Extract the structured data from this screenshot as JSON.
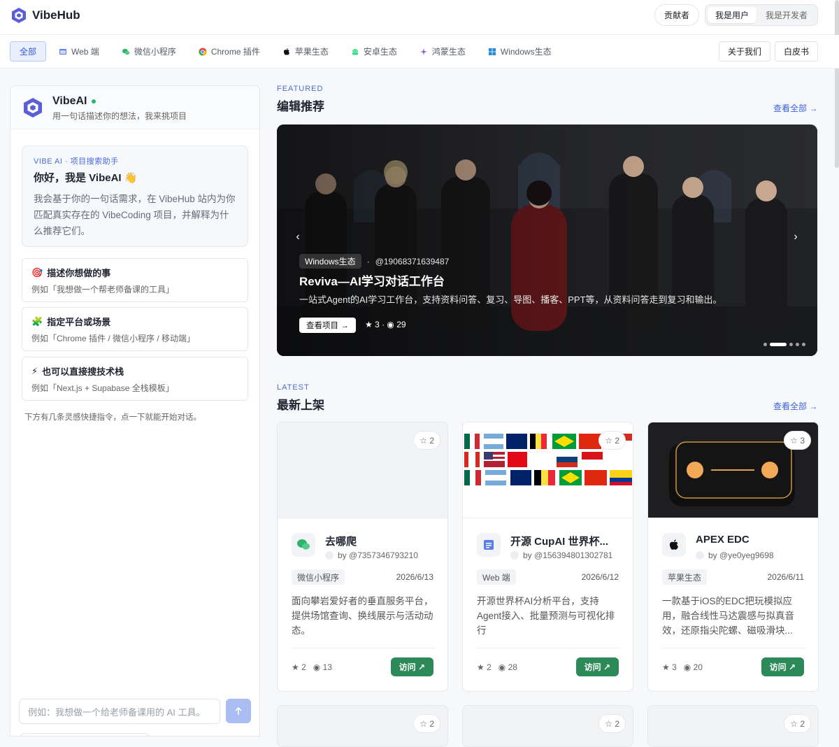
{
  "header": {
    "brand": "VibeHub",
    "contributors": "贡献者",
    "roles": [
      "我是用户",
      "我是开发者"
    ]
  },
  "nav": {
    "items": [
      {
        "label": "全部",
        "icon": "none"
      },
      {
        "label": "Web 端",
        "icon": "web-icon"
      },
      {
        "label": "微信小程序",
        "icon": "wechat-icon"
      },
      {
        "label": "Chrome 插件",
        "icon": "chrome-icon"
      },
      {
        "label": "苹果生态",
        "icon": "apple-icon"
      },
      {
        "label": "安卓生态",
        "icon": "android-icon"
      },
      {
        "label": "鸿蒙生态",
        "icon": "harmony-icon"
      },
      {
        "label": "Windows生态",
        "icon": "windows-icon"
      }
    ],
    "about": "关于我们",
    "whitepaper": "白皮书"
  },
  "chat": {
    "title": "VibeAI",
    "subtitle": "用一句话描述你的想法，我来挑项目",
    "intro_tag": "VIBE AI · 项目搜索助手",
    "intro_title": "你好，我是 VibeAI 👋",
    "intro_body": "我会基于你的一句话需求，在 VibeHub 站内为你匹配真实存在的 VibeCoding 项目，并解释为什么推荐它们。",
    "tips": [
      {
        "icon": "target-icon",
        "emoji": "🎯",
        "title": "描述你想做的事",
        "desc": "例如「我想做一个帮老师备课的工具」"
      },
      {
        "icon": "puzzle-icon",
        "emoji": "🧩",
        "title": "指定平台或场景",
        "desc": "例如「Chrome 插件 / 微信小程序 / 移动端」"
      },
      {
        "icon": "bolt-icon",
        "emoji": "⚡",
        "title": "也可以直接搜技术栈",
        "desc": "例如「Next.js + Supabase 全栈模板」"
      }
    ],
    "note": "下方有几条灵感快捷指令，点一下就能开始对话。",
    "placeholder": "例如：我想做一个给老师备课用的 AI 工具。"
  },
  "featured": {
    "kicker": "FEATURED",
    "title": "编辑推荐",
    "see_all": "查看全部 →",
    "platform": "Windows生态",
    "author": "@19068371639487",
    "project_title": "Reviva—AI学习对话工作台",
    "desc": "一站式Agent的AI学习工作台，支持资料问答、复习、导图、播客、PPT等，从资料问答走到复习和输出。",
    "button": "查看项目 →",
    "stats": "★ 3 · ◉ 29"
  },
  "latest": {
    "kicker": "LATEST",
    "title": "最新上架",
    "see_all": "查看全部 →",
    "cards": [
      {
        "title": "去哪爬",
        "author": "by @7357346793210",
        "tag": "微信小程序",
        "date": "2026/6/13",
        "desc": "面向攀岩爱好者的垂直服务平台，提供场馆查询、换线展示与活动动态。",
        "stars": "★ 2",
        "views": "◉ 13",
        "star_chip": "☆ 2",
        "visit": "访问 ↗"
      },
      {
        "title": "开源 CupAI 世界杯...",
        "author": "by @156394801302781",
        "tag": "Web 端",
        "date": "2026/6/12",
        "desc": "开源世界杯AI分析平台，支持Agent接入、批量预测与可视化排行",
        "stars": "★ 2",
        "views": "◉ 28",
        "star_chip": "☆ 2",
        "visit": "访问 ↗"
      },
      {
        "title": "APEX EDC",
        "author": "by @ye0yeg9698",
        "tag": "苹果生态",
        "date": "2026/6/11",
        "desc": "一款基于iOS的EDC把玩模拟应用，融合线性马达震感与拟真音效，还原指尖陀螺、磁吸滑块...",
        "stars": "★ 3",
        "views": "◉ 20",
        "star_chip": "☆ 3",
        "visit": "访问 ↗"
      }
    ],
    "next_row_chips": [
      "☆ 2",
      "☆ 2",
      "☆ 2"
    ]
  }
}
